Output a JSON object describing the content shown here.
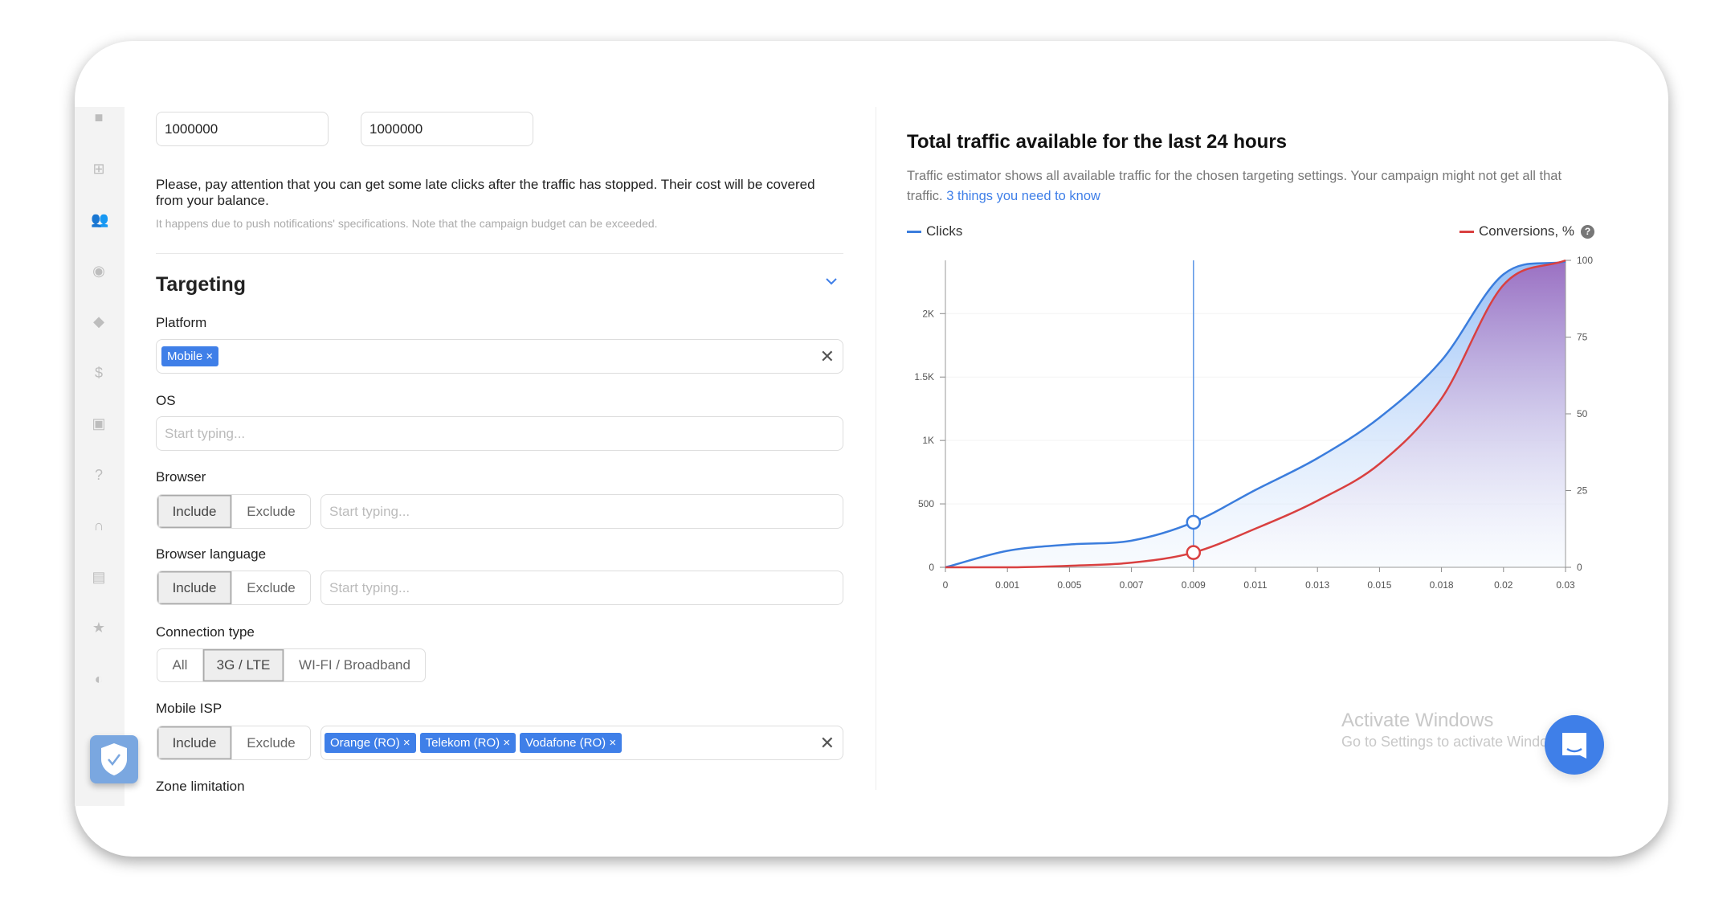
{
  "budget": {
    "daily_value": "1000000",
    "total_value": "1000000"
  },
  "notice": {
    "main": "Please, pay attention that you can get some late clicks after the traffic has stopped. Their cost will be covered from your balance.",
    "sub": "It happens due to push notifications' specifications. Note that the campaign budget can be exceeded."
  },
  "targeting": {
    "title": "Targeting",
    "platform": {
      "label": "Platform",
      "chips": [
        "Mobile"
      ]
    },
    "os": {
      "label": "OS",
      "placeholder": "Start typing..."
    },
    "browser": {
      "label": "Browser",
      "include": "Include",
      "exclude": "Exclude",
      "selected": "Include",
      "placeholder": "Start typing..."
    },
    "browser_language": {
      "label": "Browser language",
      "include": "Include",
      "exclude": "Exclude",
      "selected": "Include",
      "placeholder": "Start typing..."
    },
    "connection_type": {
      "label": "Connection type",
      "options": [
        "All",
        "3G / LTE",
        "WI-FI / Broadband"
      ],
      "selected": "3G / LTE"
    },
    "mobile_isp": {
      "label": "Mobile ISP",
      "include": "Include",
      "exclude": "Exclude",
      "selected": "Include",
      "chips": [
        "Orange (RO)",
        "Telekom (RO)",
        "Vodafone (RO)"
      ]
    },
    "zone_limitation": {
      "label": "Zone limitation"
    }
  },
  "traffic": {
    "title": "Total traffic available for the last 24 hours",
    "description": "Traffic estimator shows all available traffic for the chosen targeting settings. Your campaign might not get all that traffic.",
    "link": "3 things you need to know"
  },
  "sidebar": {
    "icons": [
      "briefcase-icon",
      "plus-box-icon",
      "users-icon",
      "eye-icon",
      "tag-icon",
      "dollar-icon",
      "wallet-icon",
      "help-icon",
      "headset-icon",
      "gift-icon",
      "star-icon",
      "referral-icon"
    ]
  },
  "watermark": {
    "title": "Activate Windows",
    "sub": "Go to Settings to activate Windows."
  },
  "colors": {
    "accent": "#3f7fe8",
    "clicks": "#3b7ddd",
    "conversions": "#d94040",
    "conversions_fill": "#9b6bbf"
  },
  "chart_data": {
    "type": "area",
    "categories": [
      "0",
      "0.001",
      "0.005",
      "0.007",
      "0.009",
      "0.011",
      "0.013",
      "0.015",
      "0.018",
      "0.02",
      "0.03"
    ],
    "series": [
      {
        "name": "Clicks",
        "axis": "left",
        "values": [
          0,
          130,
          180,
          210,
          355,
          610,
          860,
          1180,
          1630,
          2310,
          2410
        ]
      },
      {
        "name": "Conversions, %",
        "axis": "right",
        "values": [
          0,
          0,
          0.5,
          1.5,
          4.8,
          12.6,
          21.7,
          33.7,
          55,
          92,
          100
        ]
      }
    ],
    "y_left": {
      "ticks": [
        "0",
        "500",
        "1K",
        "1.5K",
        "2K"
      ],
      "tick_values": [
        0,
        500,
        1000,
        1500,
        2000
      ],
      "range": [
        0,
        2420
      ]
    },
    "y_right": {
      "ticks": [
        "0",
        "25",
        "50",
        "75",
        "100"
      ],
      "tick_values": [
        0,
        25,
        50,
        75,
        100
      ],
      "range": [
        0,
        100
      ]
    },
    "highlight_category": "0.009",
    "legend": "top",
    "grid": true
  }
}
